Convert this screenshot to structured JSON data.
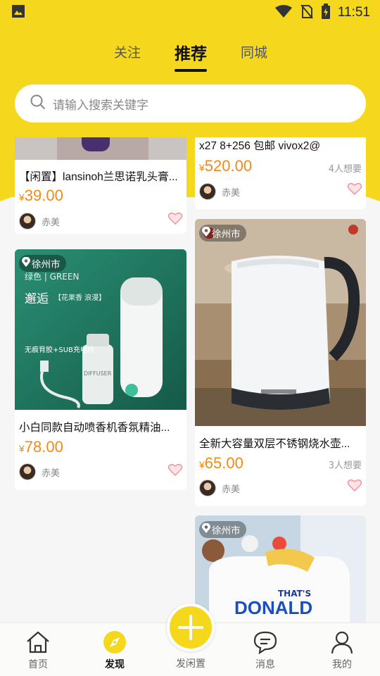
{
  "status_bar": {
    "time": "11:51"
  },
  "tabs": [
    {
      "label": "关注"
    },
    {
      "label": "推荐"
    },
    {
      "label": "同城"
    }
  ],
  "search": {
    "placeholder": "请输入搜索关键字"
  },
  "cards": {
    "left_1": {
      "title": "【闲置】lansinoh兰思诺乳头膏...",
      "price": "39.00",
      "user": "赤美"
    },
    "right_1": {
      "title": "x27 8+256 包邮 vivox2@",
      "price": "520.00",
      "wants": "4人想要",
      "user": "赤美"
    },
    "left_2": {
      "location": "徐州市",
      "title": "小白同款自动喷香机香氛精油...",
      "price": "78.00",
      "user": "赤美",
      "image_text": {
        "brand": "绿色 | GREEN",
        "heading": "邂逅",
        "subheading": "【花果香 浪漫】",
        "bullet": "无痕背胶+SUB充电线",
        "product": "DIFFUSER"
      }
    },
    "right_2": {
      "location": "徐州市",
      "title": "全新大容量双层不锈钢烧水壶...",
      "price": "65.00",
      "wants": "3人想要",
      "user": "赤美"
    },
    "right_3": {
      "location": "徐州市",
      "image_text": {
        "line1": "THAT'S",
        "line2": "DONALD"
      }
    }
  },
  "currency": "¥",
  "bottom_nav": {
    "home": "首页",
    "discover": "发现",
    "post": "发闲置",
    "messages": "消息",
    "mine": "我的"
  },
  "colors": {
    "brand_yellow": "#f5d81e",
    "price_orange": "#f28a17",
    "heart_pink": "#f08a9a"
  }
}
